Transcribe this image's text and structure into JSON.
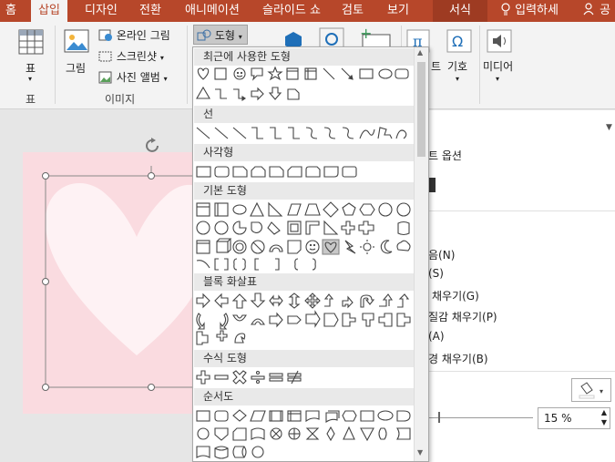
{
  "tabs": {
    "home": "홈",
    "insert": "삽입",
    "design": "디자인",
    "transitions": "전환",
    "animations": "애니메이션",
    "slideshow": "슬라이드 쇼",
    "review": "검토",
    "view": "보기",
    "format": "서식",
    "tellme": "입력하세",
    "share": "공"
  },
  "ribbon": {
    "table_label": "표",
    "table_group": "표",
    "picture_label": "그림",
    "online_picture": "온라인 그림",
    "screenshot": "스크린샷",
    "photo_album": "사진 앨범",
    "images_group": "이미지",
    "shapes_button": "도형",
    "symbol_label": "기호",
    "media_label": "미디어",
    "partial_label": "트"
  },
  "shapes_menu": {
    "sections": {
      "recent": "최근에 사용한 도형",
      "lines": "선",
      "rectangles": "사각형",
      "basic": "기본 도형",
      "block_arrows": "블록 화살표",
      "equation": "수식 도형",
      "flowchart": "순서도"
    }
  },
  "format_pane": {
    "title_partial": "트 옵션",
    "opt1": "음(N)",
    "opt2": "(S)",
    "opt3": "채우기(G)",
    "opt4": "질감 채우기(P)",
    "opt5": "(A)",
    "opt6": "경 채우기(B)",
    "transparency_value": "15 %"
  },
  "colors": {
    "accent": "#b7472a",
    "slide_bg": "#fadbe0"
  }
}
